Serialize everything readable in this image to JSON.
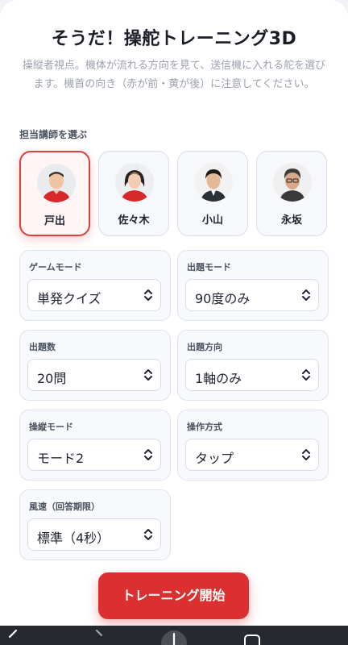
{
  "header": {
    "title": "そうだ！操舵トレーニング3D",
    "description": "操縦者視点。機体が流れる方向を見て、送信機に入れる舵を選びます。機首の向き（赤が前・黄が後）に注意してください。"
  },
  "instructors": {
    "label": "担当講師を選ぶ",
    "selected_index": 0,
    "items": [
      {
        "name": "戸出",
        "icon": "avatar-todei"
      },
      {
        "name": "佐々木",
        "icon": "avatar-sasaki"
      },
      {
        "name": "小山",
        "icon": "avatar-koyama"
      },
      {
        "name": "永坂",
        "icon": "avatar-nagasaka"
      }
    ]
  },
  "settings": {
    "game_mode": {
      "label": "ゲームモード",
      "value": "単発クイズ"
    },
    "question_mode": {
      "label": "出題モード",
      "value": "90度のみ"
    },
    "question_count": {
      "label": "出題数",
      "value": "20問"
    },
    "question_direction": {
      "label": "出題方向",
      "value": "1軸のみ"
    },
    "control_mode": {
      "label": "操縦モード",
      "value": "モード2"
    },
    "operation_method": {
      "label": "操作方式",
      "value": "タップ"
    },
    "wind_speed": {
      "label": "風速（回答期限）",
      "value": "標準（4秒）"
    }
  },
  "start_button": {
    "label": "トレーニング開始"
  },
  "colors": {
    "accent": "#dc2f30",
    "selected_border": "#d73f40",
    "card_border": "#dfe4ec",
    "muted_text": "#9aa1ad"
  },
  "system_nav": {
    "icons": [
      "back-arrow-icon",
      "forward-arrow-icon",
      "new-tab-icon",
      "tabs-icon"
    ]
  }
}
